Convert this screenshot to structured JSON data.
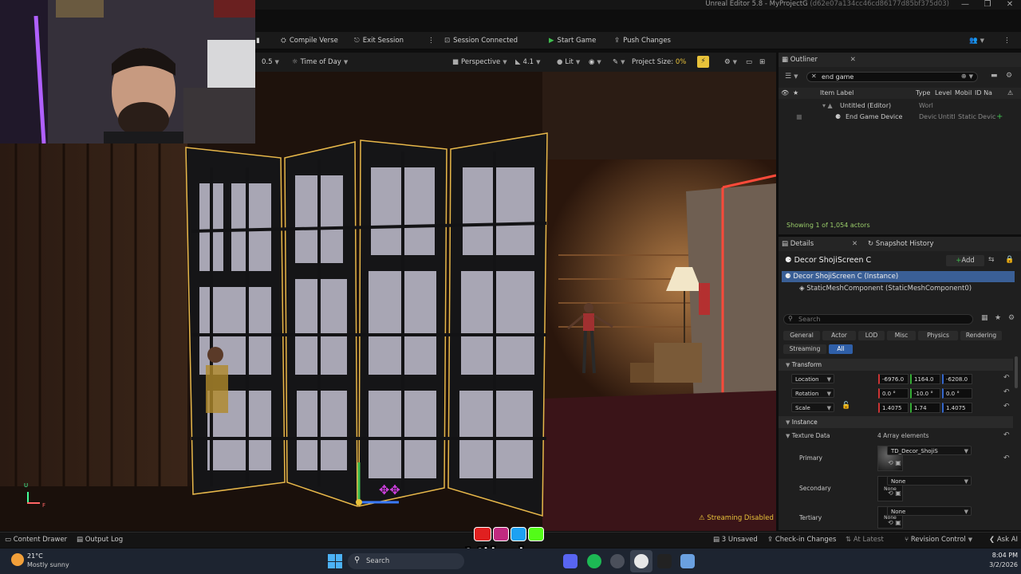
{
  "window": {
    "title": "Unreal Editor 5.8 - MyProjectG",
    "id": "(d62e07a134cc46cd86177d85bf375d03)",
    "minimize": "—",
    "maximize": "❐",
    "close": "✕"
  },
  "toolbar": {
    "compile_verse": "Compile Verse",
    "exit_session": "Exit Session",
    "session_connected": "Session Connected",
    "start_game": "Start Game",
    "push_changes": "Push Changes"
  },
  "viewport_toolbar": {
    "speed": "0.5",
    "time_of_day": "Time of Day",
    "perspective": "Perspective",
    "fov": "4.1",
    "lit": "Lit",
    "project_size_label": "Project Size:",
    "project_size_value": "0%"
  },
  "viewport": {
    "streaming_disabled": "Streaming Disabled",
    "axis_u": "U",
    "axis_f": "F"
  },
  "outliner": {
    "tab": "Outliner",
    "search_value": "end game",
    "columns": [
      "Item Label",
      "Type",
      "Level",
      "Mobil",
      "ID Na"
    ],
    "rows": [
      {
        "label": "Untitled (Editor)",
        "type": "Worl",
        "level": "",
        "mobil": "",
        "id": ""
      },
      {
        "label": "End Game Device",
        "type": "Devic",
        "level": "Untitl",
        "mobil": "Static",
        "id": "Devic"
      }
    ],
    "footer": "Showing 1 of 1,054 actors"
  },
  "details": {
    "tab": "Details",
    "tab2": "Snapshot History",
    "object_name": "Decor ShojiScreen C",
    "add_label": "Add",
    "instance_row": "Decor ShojiScreen C (Instance)",
    "component_row": "StaticMeshComponent (StaticMeshComponent0)",
    "search_placeholder": "Search",
    "filters": [
      "General",
      "Actor",
      "LOD",
      "Misc",
      "Physics",
      "Rendering",
      "Streaming",
      "All"
    ],
    "transform_label": "Transform",
    "location": {
      "label": "Location",
      "x": "-6976.0",
      "y": "1164.0",
      "z": "-6208.0"
    },
    "rotation": {
      "label": "Rotation",
      "x": "0.0 °",
      "y": "-10.0 °",
      "z": "0.0 °"
    },
    "scale": {
      "label": "Scale",
      "x": "1.4075",
      "y": "1.74",
      "z": "1.4075"
    },
    "instance_label": "Instance",
    "texture_data_label": "Texture Data",
    "texture_data_value": "4 Array elements",
    "primary_label": "Primary",
    "primary_value": "TD_Decor_ShojiS",
    "secondary_label": "Secondary",
    "secondary_value": "None",
    "tertiary_label": "Tertiary",
    "tertiary_value": "None",
    "thumb_none": "None"
  },
  "statusbar": {
    "content_drawer": "Content Drawer",
    "output_log": "Output Log",
    "unsaved": "3 Unsaved",
    "checkin": "Check-in Changes",
    "at_latest": "At Latest",
    "revision_control": "Revision Control",
    "ask_ai": "Ask AI"
  },
  "overlay": {
    "brand": "Vibzlo"
  },
  "taskbar": {
    "weather_temp": "21°C",
    "weather_desc": "Mostly sunny",
    "search": "Search",
    "time": "8:04 PM",
    "date": "3/2/2026"
  },
  "colors": {
    "accent_blue": "#2f5fa8",
    "selection_gold": "#e8b84a",
    "start_green": "#3fbf4f",
    "warning_yellow": "#e8c23a"
  }
}
